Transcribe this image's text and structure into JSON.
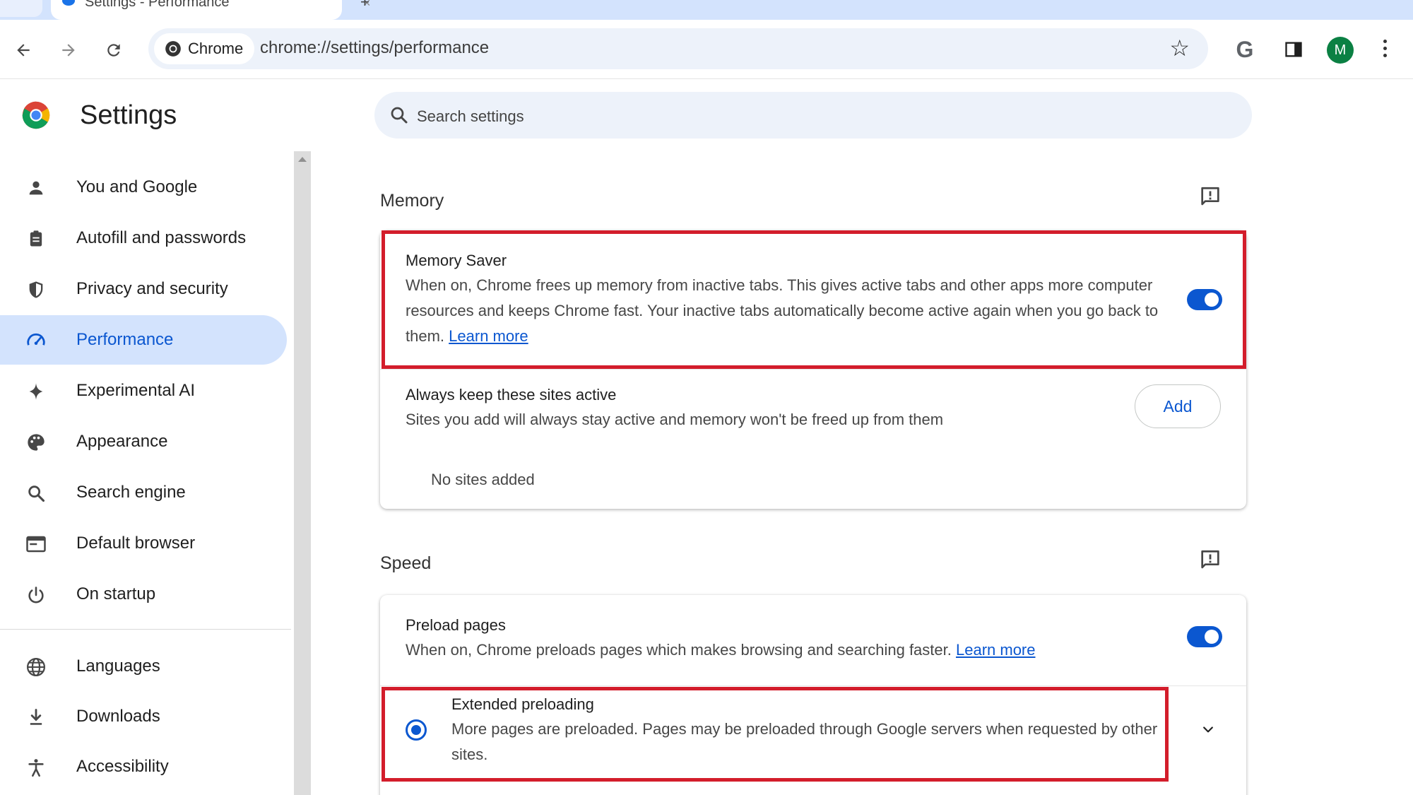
{
  "tab": {
    "title": "Settings - Performance",
    "close": "×",
    "new_tab": "+"
  },
  "toolbar": {
    "chip_label": "Chrome",
    "url": "chrome://settings/performance",
    "google_letter": "G",
    "avatar_letter": "M"
  },
  "sidebar": {
    "title": "Settings",
    "items": [
      {
        "label": "You and Google",
        "icon": "person-icon"
      },
      {
        "label": "Autofill and passwords",
        "icon": "clipboard-icon"
      },
      {
        "label": "Privacy and security",
        "icon": "shield-icon"
      },
      {
        "label": "Performance",
        "icon": "speedometer-icon",
        "active": true
      },
      {
        "label": "Experimental AI",
        "icon": "sparkle-icon"
      },
      {
        "label": "Appearance",
        "icon": "palette-icon"
      },
      {
        "label": "Search engine",
        "icon": "search-icon"
      },
      {
        "label": "Default browser",
        "icon": "browser-window-icon"
      },
      {
        "label": "On startup",
        "icon": "power-icon"
      },
      {
        "label": "Languages",
        "icon": "globe-icon"
      },
      {
        "label": "Downloads",
        "icon": "download-icon"
      },
      {
        "label": "Accessibility",
        "icon": "accessibility-icon"
      }
    ]
  },
  "search": {
    "placeholder": "Search settings"
  },
  "memory": {
    "section_title": "Memory",
    "memory_saver": {
      "title": "Memory Saver",
      "description": "When on, Chrome frees up memory from inactive tabs. This gives active tabs and other apps more computer resources and keeps Chrome fast. Your inactive tabs automatically become active again when you go back to them.",
      "link": "Learn more",
      "enabled": true
    },
    "always_active": {
      "title": "Always keep these sites active",
      "description": "Sites you add will always stay active and memory won't be freed up from them",
      "add_label": "Add",
      "empty_text": "No sites added"
    }
  },
  "speed": {
    "section_title": "Speed",
    "preload": {
      "title": "Preload pages",
      "description": "When on, Chrome preloads pages which makes browsing and searching faster.",
      "link": "Learn more",
      "enabled": true
    },
    "extended": {
      "title": "Extended preloading",
      "description": "More pages are preloaded. Pages may be preloaded through Google servers when requested by other sites.",
      "selected": true
    }
  },
  "colors": {
    "accent": "#0b57d0",
    "highlight": "#d31d2b",
    "active_nav": "#d3e3fd"
  }
}
